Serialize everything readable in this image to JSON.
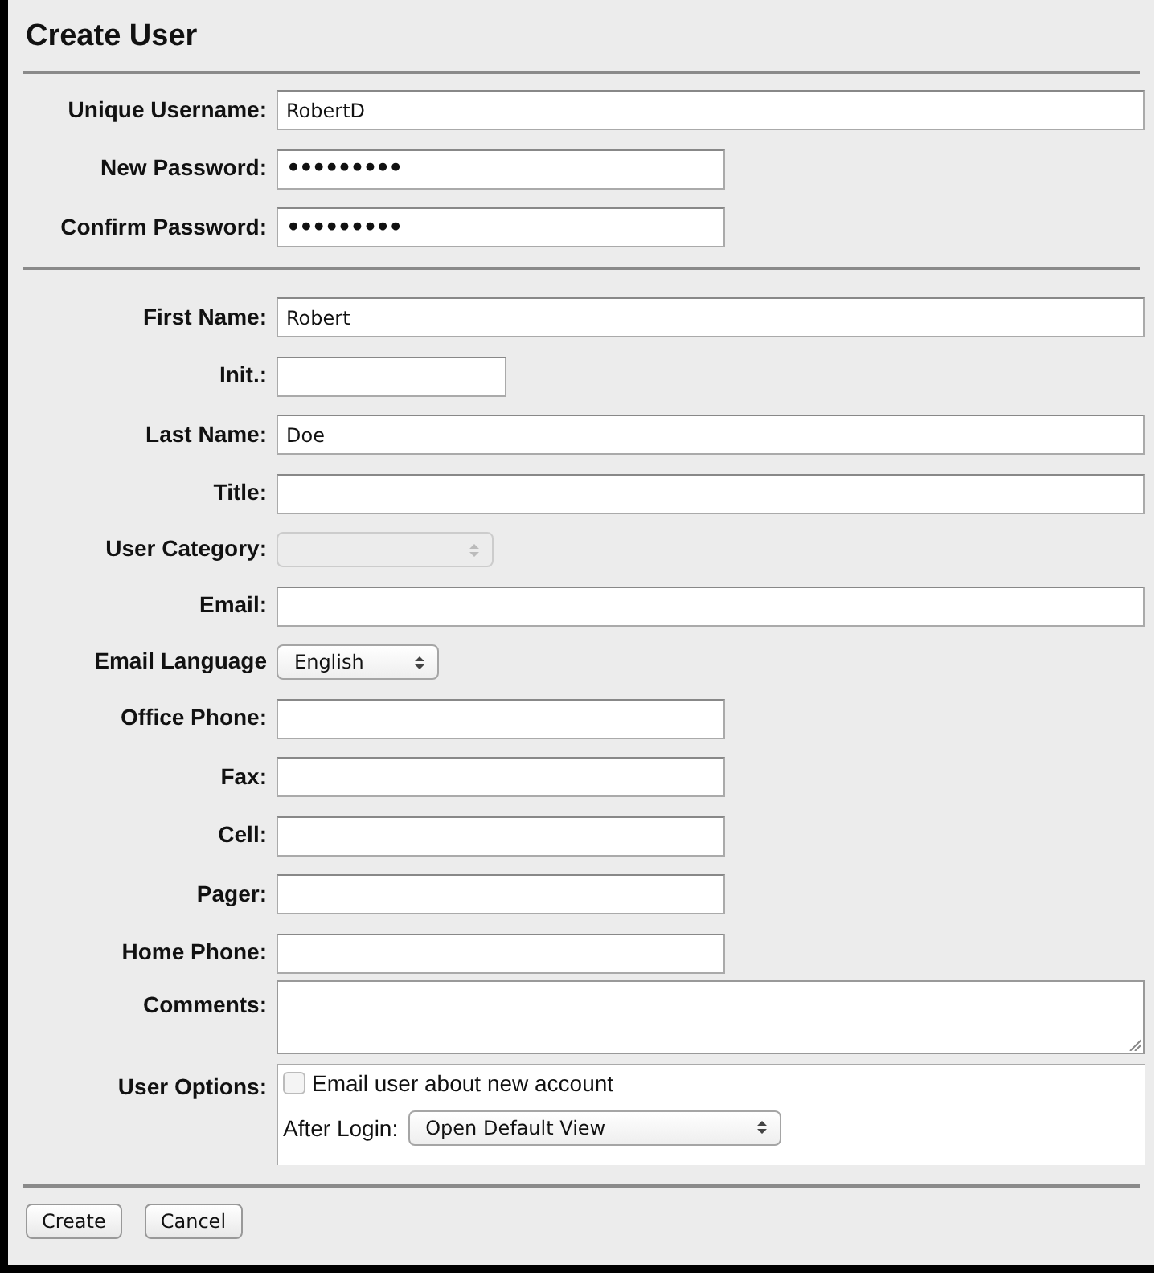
{
  "title": "Create User",
  "sections": [
    {
      "fields": [
        {
          "kind": "text",
          "label": "Unique Username:",
          "value": "RobertD"
        },
        {
          "kind": "password",
          "label": "New Password:",
          "value": "•••••••••"
        },
        {
          "kind": "password",
          "label": "Confirm Password:",
          "value": "•••••••••"
        }
      ]
    },
    {
      "fields": [
        {
          "kind": "text",
          "label": "First Name:",
          "value": "Robert"
        },
        {
          "kind": "text",
          "label": "Init.:"
        },
        {
          "kind": "text",
          "label": "Last Name:",
          "value": "Doe"
        },
        {
          "kind": "text",
          "label": "Title:"
        },
        {
          "kind": "select",
          "label": "User Category:",
          "disabled": true
        },
        {
          "kind": "text",
          "label": "Email:"
        },
        {
          "kind": "select",
          "label": "Email Language",
          "value": "English",
          "disabled": false
        },
        {
          "kind": "text",
          "label": "Office Phone:"
        },
        {
          "kind": "text",
          "label": "Fax:"
        },
        {
          "kind": "text",
          "label": "Cell:"
        },
        {
          "kind": "text",
          "label": "Pager:"
        },
        {
          "kind": "text",
          "label": "Home Phone:"
        },
        {
          "kind": "textarea",
          "label": "Comments:"
        },
        {
          "kind": "options",
          "label": "User Options:",
          "checkbox": {
            "label": "Email user about new account",
            "checked": false
          },
          "after_login": {
            "label": "After Login:",
            "value": "Open Default View"
          }
        }
      ]
    }
  ],
  "buttons": [
    {
      "label": "Create"
    },
    {
      "label": "Cancel"
    }
  ]
}
